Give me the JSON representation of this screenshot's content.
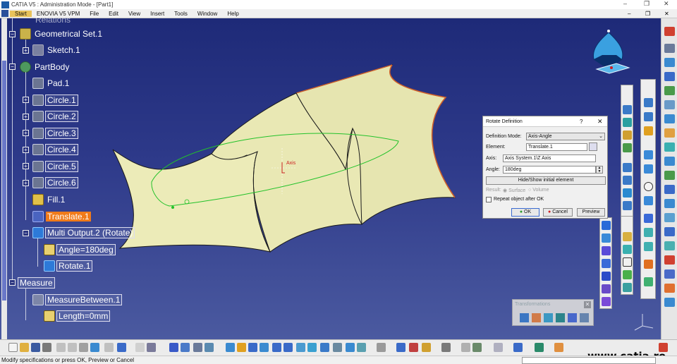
{
  "window": {
    "title": "CATIA V5 : Administration Mode - [Part1]",
    "controls": [
      "–",
      "❐",
      "✕"
    ]
  },
  "menubar": {
    "items": [
      "Start",
      "ENOVIA V5 VPM",
      "File",
      "Edit",
      "View",
      "Insert",
      "Tools",
      "Window",
      "Help"
    ],
    "doc_controls": [
      "–",
      "❐",
      "✕"
    ]
  },
  "tree": {
    "relations_partial": "Relations",
    "nodes": [
      {
        "label": "Geometrical Set.1",
        "icon": "geometrical-set-icon"
      },
      {
        "label": "Sketch.1",
        "icon": "sketch-icon"
      },
      {
        "label": "PartBody",
        "icon": "partbody-icon"
      },
      {
        "label": "Pad.1",
        "icon": "pad-icon"
      },
      {
        "label": "Circle.1",
        "icon": "circle-icon"
      },
      {
        "label": "Circle.2",
        "icon": "circle-icon"
      },
      {
        "label": "Circle.3",
        "icon": "circle-icon"
      },
      {
        "label": "Circle.4",
        "icon": "circle-icon"
      },
      {
        "label": "Circle.5",
        "icon": "circle-icon"
      },
      {
        "label": "Circle.6",
        "icon": "circle-icon"
      },
      {
        "label": "Fill.1",
        "icon": "fill-icon"
      },
      {
        "label": "Translate.1",
        "icon": "translate-icon"
      },
      {
        "label": "Multi Output.2 (Rotate)",
        "icon": "multi-output-icon"
      },
      {
        "label": "Angle=180deg",
        "icon": "parameter-icon"
      },
      {
        "label": "Rotate.1",
        "icon": "rotate-icon"
      },
      {
        "label": "Measure",
        "icon": ""
      },
      {
        "label": "MeasureBetween.1",
        "icon": "measure-between-icon"
      },
      {
        "label": "Length=0mm",
        "icon": "parameter-icon"
      }
    ]
  },
  "viewport": {
    "axis_label": "Axis"
  },
  "dialog": {
    "title": "Rotate Definition",
    "help": "?",
    "close": "✕",
    "definition_mode_label": "Definition Mode:",
    "definition_mode_value": "Axis-Angle",
    "element_label": "Element:",
    "element_value": "Translate.1",
    "axis_label": "Axis:",
    "axis_value": "Axis System.1\\Z Axis",
    "angle_label": "Angle:",
    "angle_value": "180deg",
    "hide_show_button": "Hide/Show initial element",
    "result_label": "Result:",
    "result_surface": "Surface",
    "result_volume": "Volume",
    "repeat_label": "Repeat object after OK",
    "ok_button": "OK",
    "cancel_button": "Cancel",
    "preview_button": "Preview"
  },
  "transformations_toolbar": {
    "title": "Transformations",
    "close": "✕"
  },
  "statusbar": {
    "message": "Modify specifications or press OK, Preview or Cancel"
  },
  "watermark": "www.catia.ro",
  "colors": {
    "viewport_top": "#1e2a78",
    "viewport_bottom": "#4b5aa0",
    "surface": "#e9e8b4",
    "selection": "#f07b1a",
    "axis_red": "#cc2222",
    "sketch_green": "#22c22a"
  }
}
